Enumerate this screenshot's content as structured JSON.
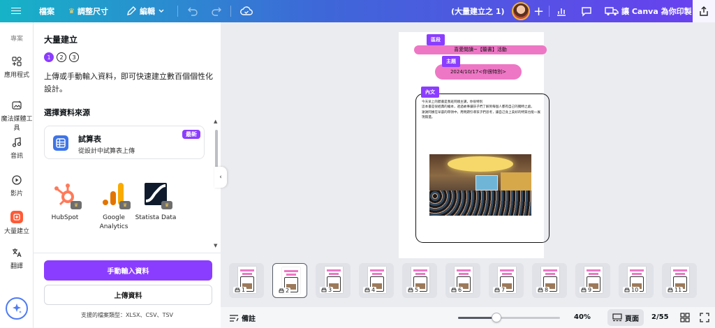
{
  "topbar": {
    "file": "檔案",
    "resize": "調整尺寸",
    "edit": "編輯",
    "title": "(大量建立之 1)",
    "print": "讓 Canva 為你印製"
  },
  "rail": {
    "items": [
      {
        "label": "專案",
        "icon": "folder-icon"
      },
      {
        "label": "應用程式",
        "icon": "apps-icon"
      },
      {
        "label": "魔法媒體工具",
        "icon": "magic-media-icon"
      },
      {
        "label": "音訊",
        "icon": "music-note-icon"
      },
      {
        "label": "影片",
        "icon": "video-icon"
      },
      {
        "label": "大量建立",
        "icon": "bulk-create-icon"
      },
      {
        "label": "翻譯",
        "icon": "translate-icon"
      }
    ]
  },
  "panel": {
    "title": "大量建立",
    "steps": [
      "1",
      "2",
      "3"
    ],
    "active_step": 1,
    "description": "上傳或手動輸入資料，即可快速建立數百個個性化設計。",
    "section_label": "選擇資料來源",
    "sheet": {
      "title": "試算表",
      "subtitle": "從設計中試算表上傳",
      "badge": "最新"
    },
    "integrations": [
      {
        "name": "HubSpot",
        "icon": "hubspot-icon"
      },
      {
        "name": "Google Analytics",
        "icon": "google-analytics-icon"
      },
      {
        "name": "Statista Data",
        "icon": "statista-icon"
      }
    ],
    "primary_button": "手動輸入資料",
    "secondary_button": "上傳資料",
    "file_types": "支援的檔案類型：XLSX、CSV、TSV"
  },
  "page": {
    "label_section": "區段",
    "header_text": "喜愛閱讀~【聽書】活動",
    "label_topic": "主題",
    "topic_text": "2024/10/17<你很特別>",
    "label_content": "內文",
    "content_text": "今天早上的聽書是我班阿姨主講，你很特別\n這本書是很經典的繪本，透過故事讓孩子們了解到每個人都有自己的獨特之處。\n謝謝阿姨在早晨的帶領中，用問題引導孩子們思考，讓自己身上美好的特質也能一展現無遺。"
  },
  "thumbnails": [
    "1",
    "2",
    "3",
    "4",
    "5",
    "6",
    "7",
    "8",
    "9",
    "10",
    "11"
  ],
  "active_thumbnail": 2,
  "bottombar": {
    "notes": "備註",
    "zoom": "40%",
    "zoom_fraction": 0.38,
    "view_label": "頁面",
    "page_count": "2/55"
  },
  "colors": {
    "accent": "#8b3dff",
    "pink": "#ee77c5",
    "bulk_create": "#ff5a36"
  }
}
